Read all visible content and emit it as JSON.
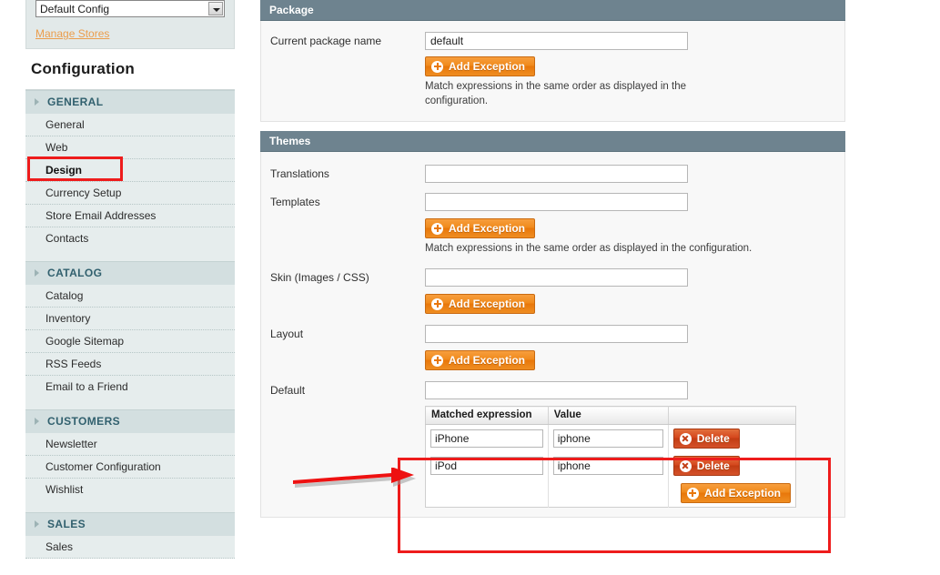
{
  "sidebar": {
    "store_switcher": {
      "selected": "Default Config",
      "dropdown_icon": "chevron-down-icon"
    },
    "manage_stores_link": "Manage Stores",
    "title": "Configuration",
    "groups": [
      {
        "label": "GENERAL",
        "items": [
          {
            "label": "General",
            "selected": false
          },
          {
            "label": "Web",
            "selected": false
          },
          {
            "label": "Design",
            "selected": true
          },
          {
            "label": "Currency Setup",
            "selected": false
          },
          {
            "label": "Store Email Addresses",
            "selected": false
          },
          {
            "label": "Contacts",
            "selected": false
          }
        ]
      },
      {
        "label": "CATALOG",
        "items": [
          {
            "label": "Catalog",
            "selected": false
          },
          {
            "label": "Inventory",
            "selected": false
          },
          {
            "label": "Google Sitemap",
            "selected": false
          },
          {
            "label": "RSS Feeds",
            "selected": false
          },
          {
            "label": "Email to a Friend",
            "selected": false
          }
        ]
      },
      {
        "label": "CUSTOMERS",
        "items": [
          {
            "label": "Newsletter",
            "selected": false
          },
          {
            "label": "Customer Configuration",
            "selected": false
          },
          {
            "label": "Wishlist",
            "selected": false
          }
        ]
      },
      {
        "label": "SALES",
        "items": [
          {
            "label": "Sales",
            "selected": false
          }
        ]
      }
    ]
  },
  "package_section": {
    "title": "Package",
    "current_package_name_label": "Current package name",
    "current_package_name_value": "default",
    "add_exception_label": "Add Exception",
    "hint": "Match expressions in the same order as displayed in the configuration."
  },
  "themes_section": {
    "title": "Themes",
    "translations_label": "Translations",
    "translations_value": "",
    "templates_label": "Templates",
    "templates_value": "",
    "templates_add_exception_label": "Add Exception",
    "templates_hint": "Match expressions in the same order as displayed in the configuration.",
    "skin_label": "Skin (Images / CSS)",
    "skin_value": "",
    "skin_add_exception_label": "Add Exception",
    "layout_label": "Layout",
    "layout_value": "",
    "layout_add_exception_label": "Add Exception",
    "default_label": "Default",
    "default_value": "",
    "exceptions_grid": {
      "columns": [
        "Matched expression",
        "Value",
        ""
      ],
      "rows": [
        {
          "expression": "iPhone",
          "value": "iphone",
          "delete_label": "Delete"
        },
        {
          "expression": "iPod",
          "value": "iphone",
          "delete_label": "Delete"
        }
      ],
      "add_exception_label": "Add Exception"
    }
  },
  "annotations": {
    "highlight_color": "#ee1c1c",
    "arrow": "red-arrow-pointing-right",
    "design_box": "red-box-around-design-nav-item",
    "grid_box": "red-box-around-exceptions-grid"
  },
  "colors": {
    "panel_header": "#6e838f",
    "button_orange": "#e8770a",
    "button_red": "#c23c13",
    "link_orange": "#eb9d4c",
    "nav_group_text": "#31606e"
  }
}
